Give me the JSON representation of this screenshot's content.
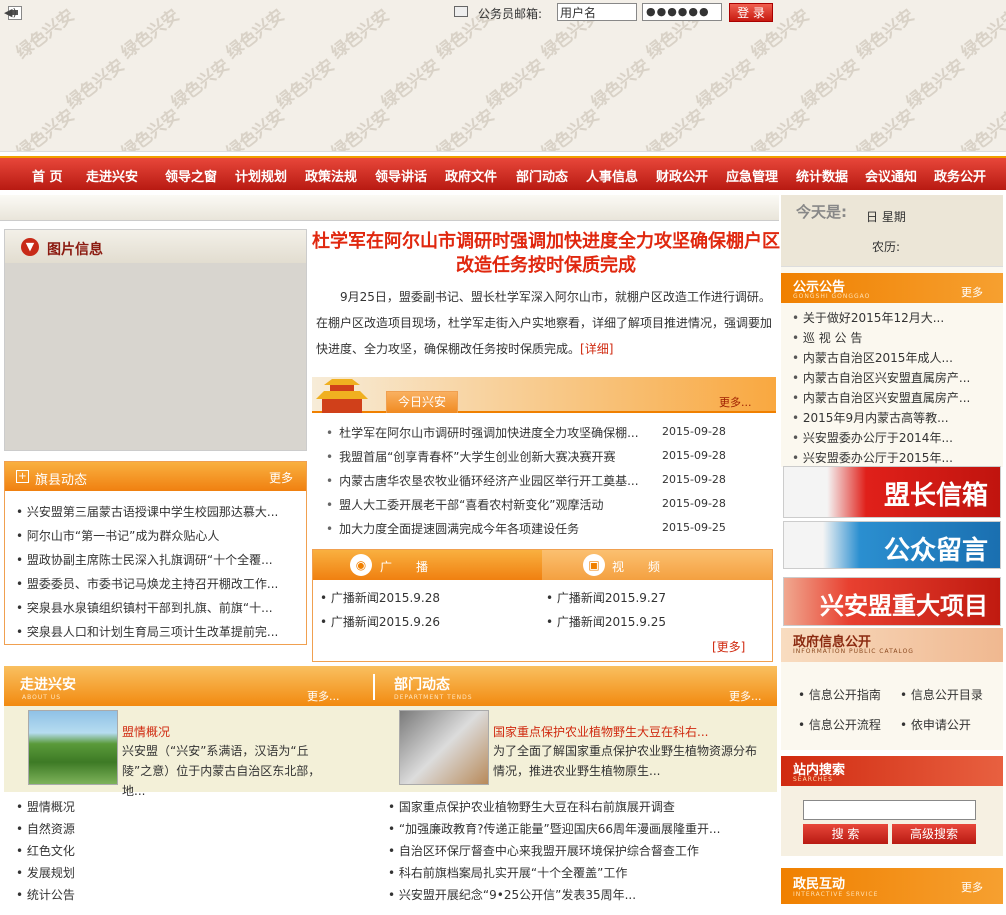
{
  "nav": [
    "首 页",
    "走进兴安",
    "领导之窗",
    "计划规划",
    "政策法规",
    "领导讲话",
    "政府文件",
    "部门动态",
    "人事信息",
    "财政公开",
    "应急管理",
    "统计数据",
    "会议通知",
    "政务公开"
  ],
  "banner": {
    "watermark": "绿色兴安"
  },
  "login": {
    "mail_label": "公务员邮箱:",
    "user_value": "用户名",
    "password_mask": "●●●●●●",
    "button": "登 录"
  },
  "date": {
    "today_label": "今天是:",
    "day_text": "日  星期",
    "lunar_text": "农历:"
  },
  "pictures": {
    "title": "图片信息"
  },
  "headline": {
    "title": "杜学军在阿尔山市调研时强调加快进度全力攻坚确保棚户区改造任务按时保质完成",
    "summary": "9月25日，盟委副书记、盟长杜学军深入阿尔山市，就棚户区改造工作进行调研。在棚户区改造项目现场，杜学军走街入户实地察看，详细了解项目推进情况，强调要加快进度、全力攻坚，确保棚改任务按时保质完成。",
    "more": "[详细]"
  },
  "today_xingan": {
    "tab": "今日兴安",
    "more": "更多...",
    "items": [
      {
        "title": "杜学军在阿尔山市调研时强调加快进度全力攻坚确保棚...",
        "date": "2015-09-28"
      },
      {
        "title": "我盟首届“创享青春杯”大学生创业创新大赛决赛开赛",
        "date": "2015-09-28"
      },
      {
        "title": "内蒙古唐华农垦农牧业循环经济产业园区举行开工奠基...",
        "date": "2015-09-28"
      },
      {
        "title": "盟人大工委开展老干部“喜看农村新变化”观摩活动",
        "date": "2015-09-28"
      },
      {
        "title": "加大力度全面提速圆满完成今年各项建设任务",
        "date": "2015-09-25"
      }
    ]
  },
  "media": {
    "radio_label": "广播",
    "video_label": "视频",
    "radio": [
      "广播新闻2015.9.28",
      "广播新闻2015.9.26"
    ],
    "video": [
      "广播新闻2015.9.27",
      "广播新闻2015.9.25"
    ],
    "more": "[更多]"
  },
  "qixian": {
    "title": "旗县动态",
    "more": "更多",
    "items": [
      "兴安盟第三届蒙古语授课中学生校园那达慕大...",
      "阿尔山市“第一书记”成为群众贴心人",
      "盟政协副主席陈士民深入扎旗调研“十个全覆...",
      "盟委委员、市委书记马焕龙主持召开棚改工作...",
      "突泉县水泉镇组织镇村干部到扎旗、前旗“十...",
      "突泉县人口和计划生育局三项计生改革提前完..."
    ]
  },
  "bottom": {
    "left": {
      "title": "走进兴安",
      "sub": "ABOUT US",
      "more": "更多...",
      "feature_title": "盟情概况",
      "feature_text": "兴安盟（“兴安”系满语，汉语为“丘陵”之意）位于内蒙古自治区东北部，地...",
      "items": [
        "盟情概况",
        "自然资源",
        "红色文化",
        "发展规划",
        "统计公告"
      ]
    },
    "right": {
      "title": "部门动态",
      "sub": "DEPARTMENT TENDS",
      "more": "更多...",
      "feature_title": "国家重点保护农业植物野生大豆在科右...",
      "feature_text": "为了全面了解国家重点保护农业野生植物资源分布情况，推进农业野生植物原生...",
      "items": [
        "国家重点保护农业植物野生大豆在科右前旗展开调查",
        "“加强廉政教育?传递正能量”暨迎国庆66周年漫画展隆重开...",
        "自治区环保厅督查中心来我盟开展环境保护综合督查工作",
        "科右前旗档案局扎实开展“十个全覆盖”工作",
        "兴安盟开展纪念“9•25公开信”发表35周年..."
      ]
    }
  },
  "notice": {
    "title": "公示公告",
    "sub": "GONGSHI GONGGAO",
    "more": "更多",
    "items": [
      "关于做好2015年12月大...",
      "巡 视 公 告",
      "内蒙古自治区2015年成人...",
      "内蒙古自治区兴安盟直属房产...",
      "内蒙古自治区兴安盟直属房产...",
      "2015年9月内蒙古高等教...",
      "兴安盟委办公厅于2014年...",
      "兴安盟委办公厅于2015年..."
    ]
  },
  "promos": [
    "盟长信箱",
    "公众留言",
    "兴安盟重大项目"
  ],
  "gov_info": {
    "title": "政府信息公开",
    "sub": "INFORMATION PUBLIC CATALOG",
    "items": [
      "信息公开指南",
      "信息公开目录",
      "信息公开流程",
      "依申请公开"
    ]
  },
  "search": {
    "title": "站内搜索",
    "sub": "SEARCHES",
    "button": "搜 索",
    "advanced": "高级搜索"
  },
  "interact": {
    "title": "政民互动",
    "sub": "INTERACTIVE SERVICE",
    "more": "更多"
  },
  "colors": {
    "nav_red": "#c8201a",
    "accent_orange": "#f08000",
    "headline_red": "#e0280f"
  }
}
